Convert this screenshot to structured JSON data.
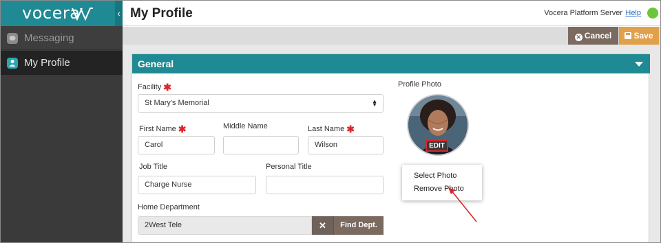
{
  "brand": {
    "logo_text": "vocera",
    "colors": {
      "teal": "#1f8a93",
      "sidebar": "#3a3a3a",
      "cancel": "#7b6a60",
      "save": "#e0a04c",
      "required": "#d9262c",
      "status": "#6cc63a"
    }
  },
  "sidebar": {
    "collapse_icon": "chevron-left-icon",
    "items": [
      {
        "label": "Messaging",
        "icon": "chat-bubble-icon",
        "active": false
      },
      {
        "label": "My Profile",
        "icon": "user-icon",
        "active": true
      }
    ]
  },
  "header": {
    "title": "My Profile",
    "server": "Vocera Platform Server",
    "help": "Help",
    "status": "online"
  },
  "toolbar": {
    "cancel_label": "Cancel",
    "save_label": "Save"
  },
  "panel": {
    "title": "General"
  },
  "form": {
    "facility": {
      "label": "Facility",
      "required": true,
      "value": "St Mary's Memorial"
    },
    "first_name": {
      "label": "First Name",
      "required": true,
      "value": "Carol"
    },
    "middle_name": {
      "label": "Middle Name",
      "required": false,
      "value": ""
    },
    "last_name": {
      "label": "Last Name",
      "required": true,
      "value": "Wilson"
    },
    "job_title": {
      "label": "Job Title",
      "value": "Charge Nurse"
    },
    "personal_title": {
      "label": "Personal Title",
      "value": ""
    },
    "home_department": {
      "label": "Home Department",
      "value": "2West Tele",
      "find_label": "Find Dept."
    }
  },
  "photo": {
    "label": "Profile Photo",
    "edit_label": "EDIT",
    "menu": [
      "Select Photo",
      "Remove Photo"
    ]
  }
}
